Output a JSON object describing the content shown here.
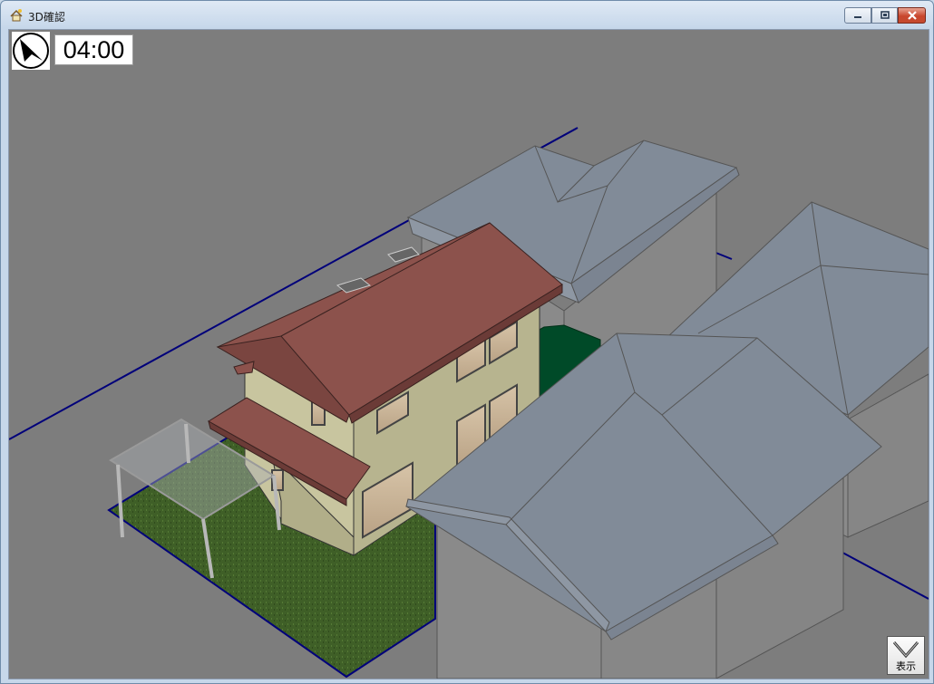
{
  "window": {
    "title": "3D確認"
  },
  "overlay": {
    "time": "04:00",
    "compass_icon": "compass-arrow-icon"
  },
  "display_button": {
    "label": "表示",
    "icon": "chevron-down-icon"
  },
  "colors": {
    "sky": "#7d7d7d",
    "roof_main": "#8c524c",
    "wall_main": "#c8c59f",
    "roof_neighbor": "#818b98",
    "wall_neighbor": "#8a8a8a",
    "lawn": "#3f5f27",
    "hedge": "#004a28",
    "boundary": "#00007a"
  }
}
